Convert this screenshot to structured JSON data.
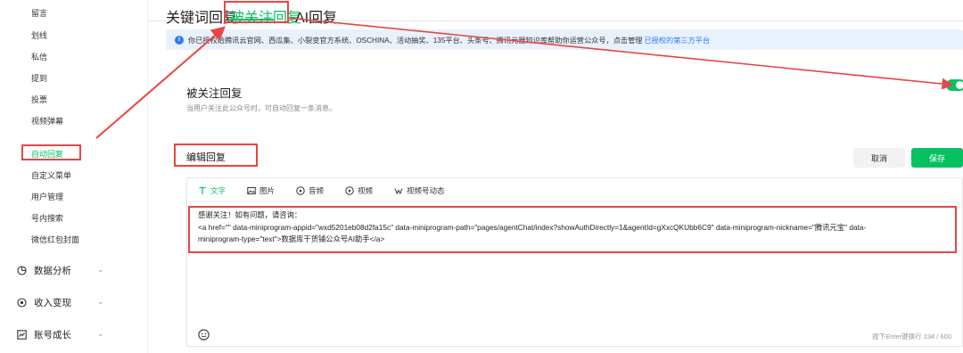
{
  "sidebar": {
    "items": [
      {
        "label": "留言"
      },
      {
        "label": "划线"
      },
      {
        "label": "私信"
      },
      {
        "label": "提到"
      },
      {
        "label": "投票"
      },
      {
        "label": "视频弹幕"
      },
      {
        "label": "自动回复",
        "active": true
      },
      {
        "label": "自定义菜单"
      },
      {
        "label": "用户管理"
      },
      {
        "label": "号内搜索"
      },
      {
        "label": "微信红包封面"
      }
    ],
    "groups": [
      {
        "label": "数据分析",
        "icon": "chart-pie-icon"
      },
      {
        "label": "收入变现",
        "icon": "coin-icon"
      },
      {
        "label": "账号成长",
        "icon": "growth-chart-icon"
      }
    ]
  },
  "tabs": [
    {
      "label": "关键词回复"
    },
    {
      "label": "被关注回复",
      "active": true
    },
    {
      "label": "AI回复"
    }
  ],
  "banner": {
    "text": "你已授权给腾讯云官网、西瓜集、小裂变官方系统、OSCHINA、活动抽奖、135平台、头条号、腾讯元器知识库帮助你运营公众号，点击管理",
    "link": "已授权的第三方平台"
  },
  "section": {
    "title": "被关注回复",
    "description": "当用户关注此公众号时，可自动回复一条消息。",
    "toggle_on": true
  },
  "editor": {
    "title": "编辑回复",
    "cancel_label": "取消",
    "save_label": "保存",
    "tools": [
      {
        "label": "文字",
        "icon": "text-icon",
        "active": true
      },
      {
        "label": "图片",
        "icon": "image-icon"
      },
      {
        "label": "音频",
        "icon": "audio-icon"
      },
      {
        "label": "视频",
        "icon": "video-icon"
      },
      {
        "label": "视频号动态",
        "icon": "channels-icon"
      }
    ],
    "content_lines": [
      "感谢关注！如有问题，请咨询：",
      "<a href=\"\" data-miniprogram-appid=\"wxd5201eb08d2fa15c\" data-miniprogram-path=\"pages/agentChat/index?showAuthDirectly=1&agentId=gXxcQKUbb6C9\" data-miniprogram-nickname=\"腾讯元宝\" data-",
      "miniprogram-type=\"text\">数据库干货铺公众号AI助手</a>"
    ],
    "counter": "按下Enter键换行 234 / 600"
  },
  "colors": {
    "accent": "#07c160",
    "link": "#2f7bf5",
    "annotation": "#e84545",
    "banner_bg": "#e9f1fd"
  }
}
